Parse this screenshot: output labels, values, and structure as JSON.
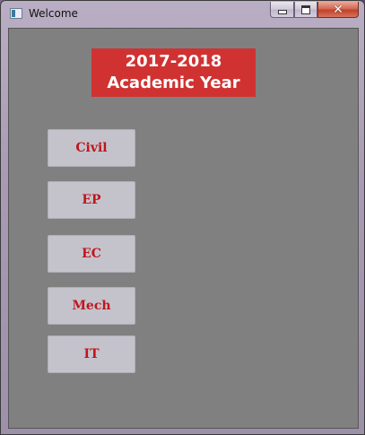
{
  "window": {
    "title": "Welcome",
    "controls": {
      "minimize": "minimize",
      "maximize": "maximize",
      "close": "✕"
    }
  },
  "banner": {
    "line1": "2017-2018",
    "line2": "Academic Year",
    "color": "#d03232"
  },
  "departments": [
    "Civil",
    "EP",
    "EC",
    "Mech",
    "IT"
  ],
  "colors": {
    "client_bg": "#808080",
    "button_bg": "#c4c3cc",
    "button_text": "#c0161c"
  }
}
